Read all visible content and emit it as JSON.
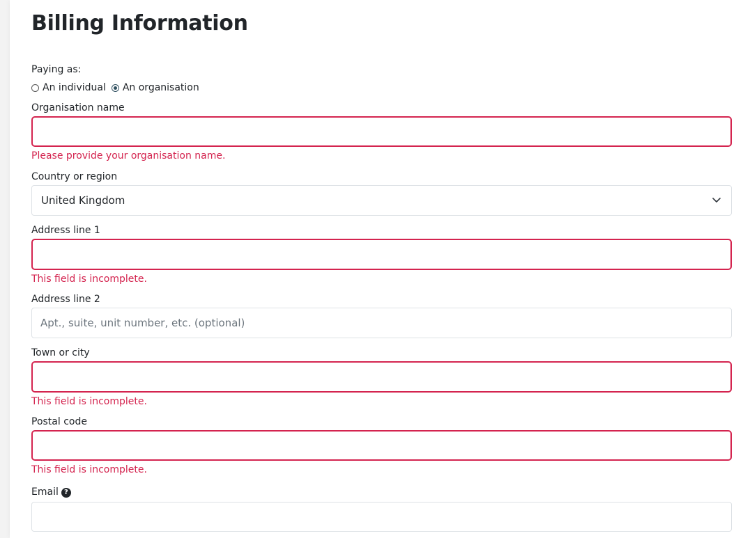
{
  "page": {
    "title": "Billing Information"
  },
  "paying_as": {
    "label": "Paying as:",
    "options": [
      "An individual",
      "An organisation"
    ],
    "selected": "An organisation"
  },
  "organisation_name": {
    "label": "Organisation name",
    "value": "",
    "error": "Please provide your organisation name."
  },
  "country": {
    "label": "Country or region",
    "value": "United Kingdom"
  },
  "address_line_1": {
    "label": "Address line 1",
    "value": "",
    "error": "This field is incomplete."
  },
  "address_line_2": {
    "label": "Address line 2",
    "value": "",
    "placeholder": "Apt., suite, unit number, etc. (optional)"
  },
  "town": {
    "label": "Town or city",
    "value": "",
    "error": "This field is incomplete."
  },
  "postal_code": {
    "label": "Postal code",
    "value": "",
    "error": "This field is incomplete."
  },
  "email": {
    "label": "Email",
    "help_icon": "?",
    "value": ""
  },
  "colors": {
    "error": "#d4244f",
    "radio_checked": "#2f4f5f",
    "border": "#dee2e6"
  },
  "icons": {
    "country_dropdown": "chevron-down-icon",
    "email_help": "question-circle-icon"
  }
}
